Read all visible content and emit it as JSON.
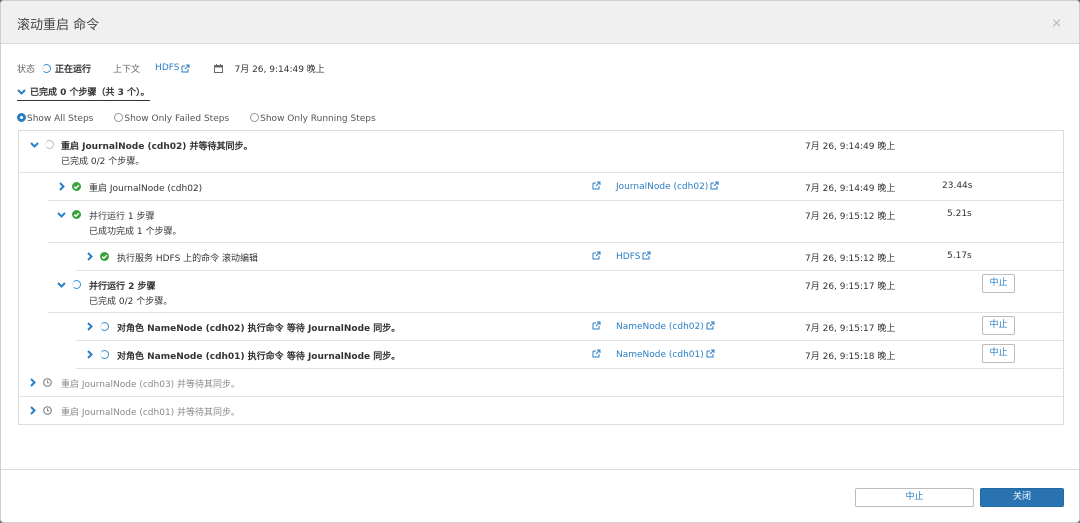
{
  "dialog": {
    "title": "滚动重启 命令",
    "close_glyph": "×"
  },
  "status": {
    "label": "状态",
    "value": "正在运行",
    "context_label": "上下文",
    "context_link": "HDFS",
    "time": "7月 26, 9:14:49 晚上"
  },
  "progress": {
    "text": "已完成 0 个步骤（共 3 个）。"
  },
  "filters": [
    {
      "label": "Show All Steps",
      "selected": true
    },
    {
      "label": "Show Only Failed Steps",
      "selected": false
    },
    {
      "label": "Show Only Running Steps",
      "selected": false
    }
  ],
  "steps": [
    {
      "title": "重启 JournalNode (cdh02) 并等待其同步。",
      "sub": "已完成 0/2 个步骤。",
      "time": "7月 26, 9:14:49 晚上",
      "state": "running",
      "expanded": true
    },
    {
      "title": "重启 JournalNode (cdh02)",
      "link": "JournalNode (cdh02)",
      "time": "7月 26, 9:14:49 晚上",
      "duration": "23.44s",
      "state": "success",
      "expanded": false
    },
    {
      "title": "并行运行 1 步骤",
      "sub": "已成功完成 1 个步骤。",
      "time": "7月 26, 9:15:12 晚上",
      "duration": "5.21s",
      "state": "success",
      "expanded": true
    },
    {
      "title": "执行服务 HDFS 上的命令 滚动编辑",
      "link": "HDFS",
      "time": "7月 26, 9:15:12 晚上",
      "duration": "5.17s",
      "state": "success",
      "expanded": false
    },
    {
      "title": "并行运行 2 步骤",
      "sub": "已完成 0/2 个步骤。",
      "time": "7月 26, 9:15:17 晚上",
      "state": "running",
      "expanded": true,
      "action": "中止"
    },
    {
      "title": "对角色 NameNode (cdh02) 执行命令 等待 JournalNode 同步。",
      "link": "NameNode (cdh02)",
      "time": "7月 26, 9:15:17 晚上",
      "state": "running",
      "expanded": false,
      "action": "中止"
    },
    {
      "title": "对角色 NameNode (cdh01) 执行命令 等待 JournalNode 同步。",
      "link": "NameNode (cdh01)",
      "time": "7月 26, 9:15:18 晚上",
      "state": "running",
      "expanded": false,
      "action": "中止"
    },
    {
      "title": "重启 JournalNode (cdh03) 并等待其同步。",
      "state": "pending",
      "expanded": false
    },
    {
      "title": "重启 JournalNode (cdh01) 并等待其同步。",
      "state": "pending",
      "expanded": false
    }
  ],
  "footer": {
    "abort_label": "中止",
    "close_label": "关闭"
  },
  "colors": {
    "accent": "#2a7ec3",
    "success": "#3aa13a",
    "primary_button": "#2a73b3"
  },
  "icons": {
    "external": "external-link-icon",
    "calendar": "calendar-icon",
    "success": "check-circle-icon",
    "running": "spinner-icon",
    "pending": "clock-icon"
  }
}
